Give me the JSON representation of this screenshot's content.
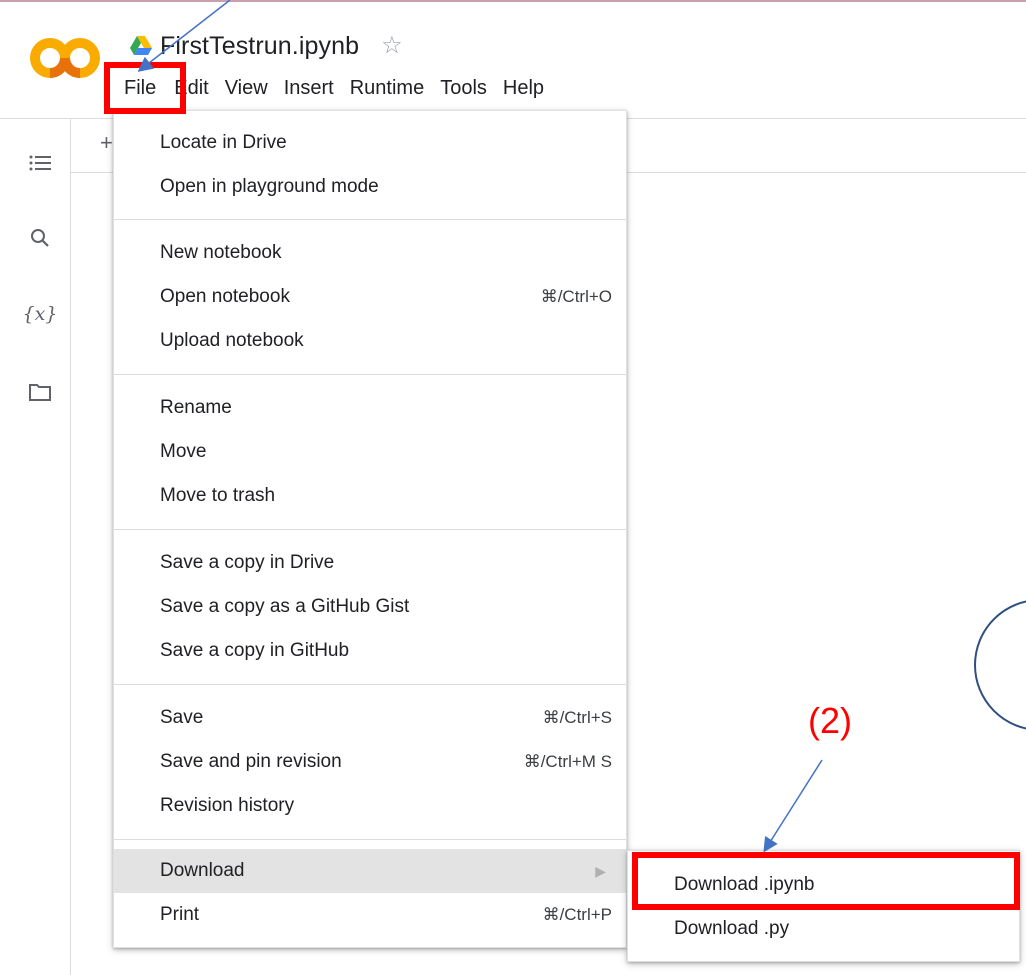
{
  "app": {
    "logo_text": "CO",
    "document_title": "FirstTestrun.ipynb",
    "accent_orange": "#f9ab00",
    "accent_red": "#ff0000"
  },
  "menubar": {
    "items": [
      "File",
      "Edit",
      "View",
      "Insert",
      "Runtime",
      "Tools",
      "Help"
    ]
  },
  "toolbar": {
    "plus_label": "+"
  },
  "sidebar": {
    "icons": [
      "table-of-contents-icon",
      "search-icon",
      "variables-icon",
      "folder-icon"
    ],
    "variables_label": "{x}"
  },
  "file_menu": {
    "items": [
      {
        "label": "Locate in Drive",
        "shortcut": ""
      },
      {
        "label": "Open in playground mode",
        "shortcut": ""
      },
      {
        "label": "New notebook",
        "shortcut": ""
      },
      {
        "label": "Open notebook",
        "shortcut": "⌘/Ctrl+O"
      },
      {
        "label": "Upload notebook",
        "shortcut": ""
      },
      {
        "label": "Rename",
        "shortcut": ""
      },
      {
        "label": "Move",
        "shortcut": ""
      },
      {
        "label": "Move to trash",
        "shortcut": ""
      },
      {
        "label": "Save a copy in Drive",
        "shortcut": ""
      },
      {
        "label": "Save a copy as a GitHub Gist",
        "shortcut": ""
      },
      {
        "label": "Save a copy in GitHub",
        "shortcut": ""
      },
      {
        "label": "Save",
        "shortcut": "⌘/Ctrl+S"
      },
      {
        "label": "Save and pin revision",
        "shortcut": "⌘/Ctrl+M S"
      },
      {
        "label": "Revision history",
        "shortcut": ""
      },
      {
        "label": "Download",
        "shortcut": ""
      },
      {
        "label": "Print",
        "shortcut": "⌘/Ctrl+P"
      }
    ],
    "highlighted_item": "Download"
  },
  "download_submenu": {
    "items": [
      "Download .ipynb",
      "Download .py"
    ]
  },
  "annotations": {
    "step_label": "(2)"
  }
}
